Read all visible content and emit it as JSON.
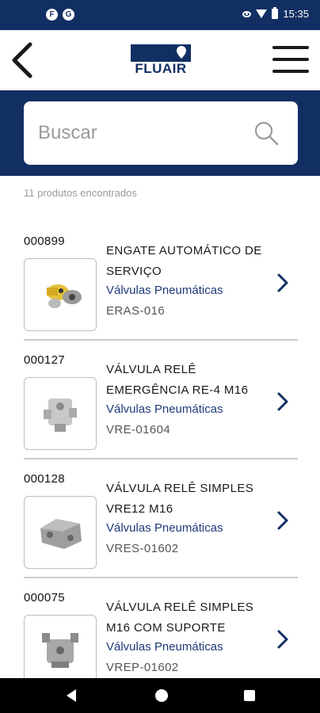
{
  "status_bar": {
    "left_icons": [
      "F",
      "G"
    ],
    "time": "15:35",
    "icons": [
      "eye-icon",
      "wifi-icon",
      "battery-icon"
    ]
  },
  "header": {
    "logo_text": "FLUAIR",
    "back_icon": "chevron-left-icon",
    "menu_icon": "hamburger-menu-icon"
  },
  "search": {
    "placeholder": "Buscar",
    "value": ""
  },
  "results_count": "11 produtos encontrados",
  "products": [
    {
      "code": "000899",
      "name": "ENGATE AUTOMÁTICO DE SERVIÇO",
      "category": "Válvulas Pneumáticas",
      "sku": "ERAS-016",
      "image": "yellow-coupling"
    },
    {
      "code": "000127",
      "name": "VÁLVULA RELÊ EMERGÊNCIA RE-4 M16",
      "category": "Válvulas Pneumáticas",
      "sku": "VRE-01604",
      "image": "silver-valve"
    },
    {
      "code": "000128",
      "name": "VÁLVULA RELÊ SIMPLES VRE12 M16",
      "category": "Válvulas Pneumáticas",
      "sku": "VRES-01602",
      "image": "grey-valve"
    },
    {
      "code": "000075",
      "name": "VÁLVULA RELÊ SIMPLES M16 COM SUPORTE",
      "category": "Válvulas Pneumáticas",
      "sku": "VREP-01602",
      "image": "valve-bracket"
    }
  ],
  "colors": {
    "brand_navy": "#122f63",
    "category_blue": "#1f3a7a"
  }
}
